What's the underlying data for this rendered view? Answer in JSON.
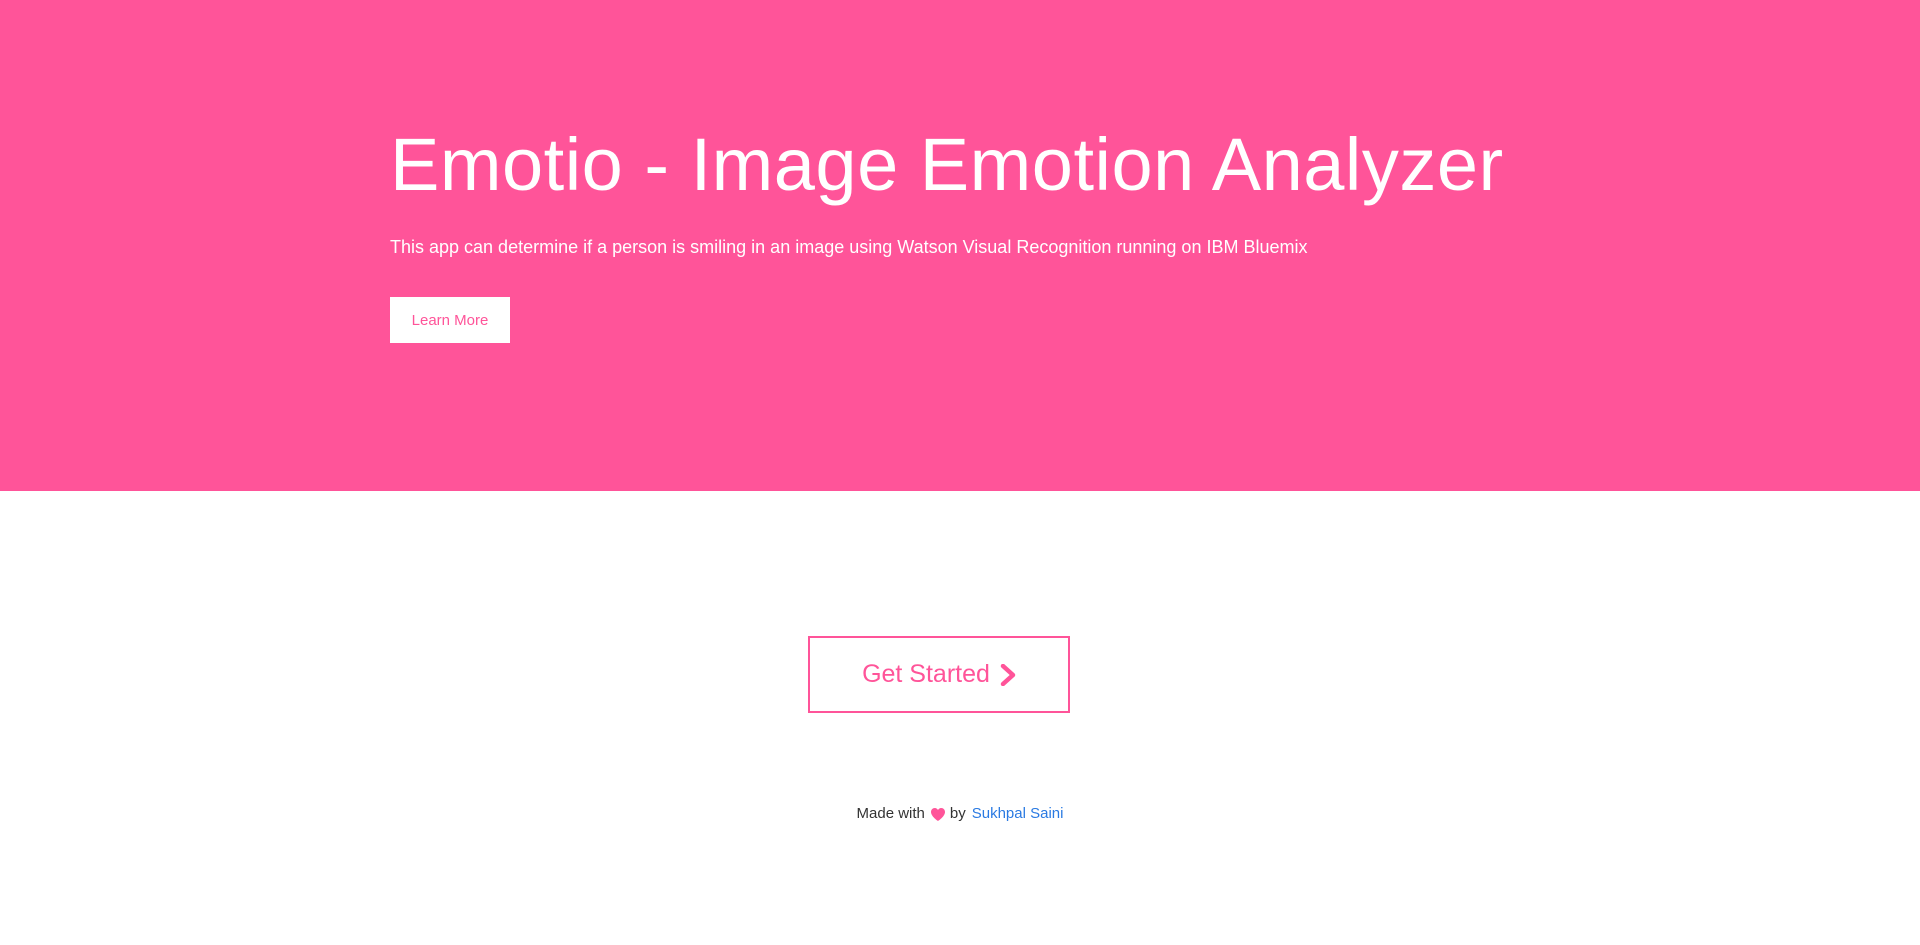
{
  "hero": {
    "title": "Emotio - Image Emotion Analyzer",
    "subtitle": "This app can determine if a person is smiling in an image using Watson Visual Recognition running on IBM Bluemix",
    "learn_more_label": "Learn More",
    "background_color": "#ff5499"
  },
  "cta": {
    "label": "Get Started",
    "icon": "chevron-right-icon",
    "accent_color": "#ff5499"
  },
  "footer": {
    "made_with": "Made with",
    "heart_icon": "heart-icon",
    "by": "by",
    "author": "Sukhpal Saini",
    "link_color": "#2a7ae2"
  }
}
